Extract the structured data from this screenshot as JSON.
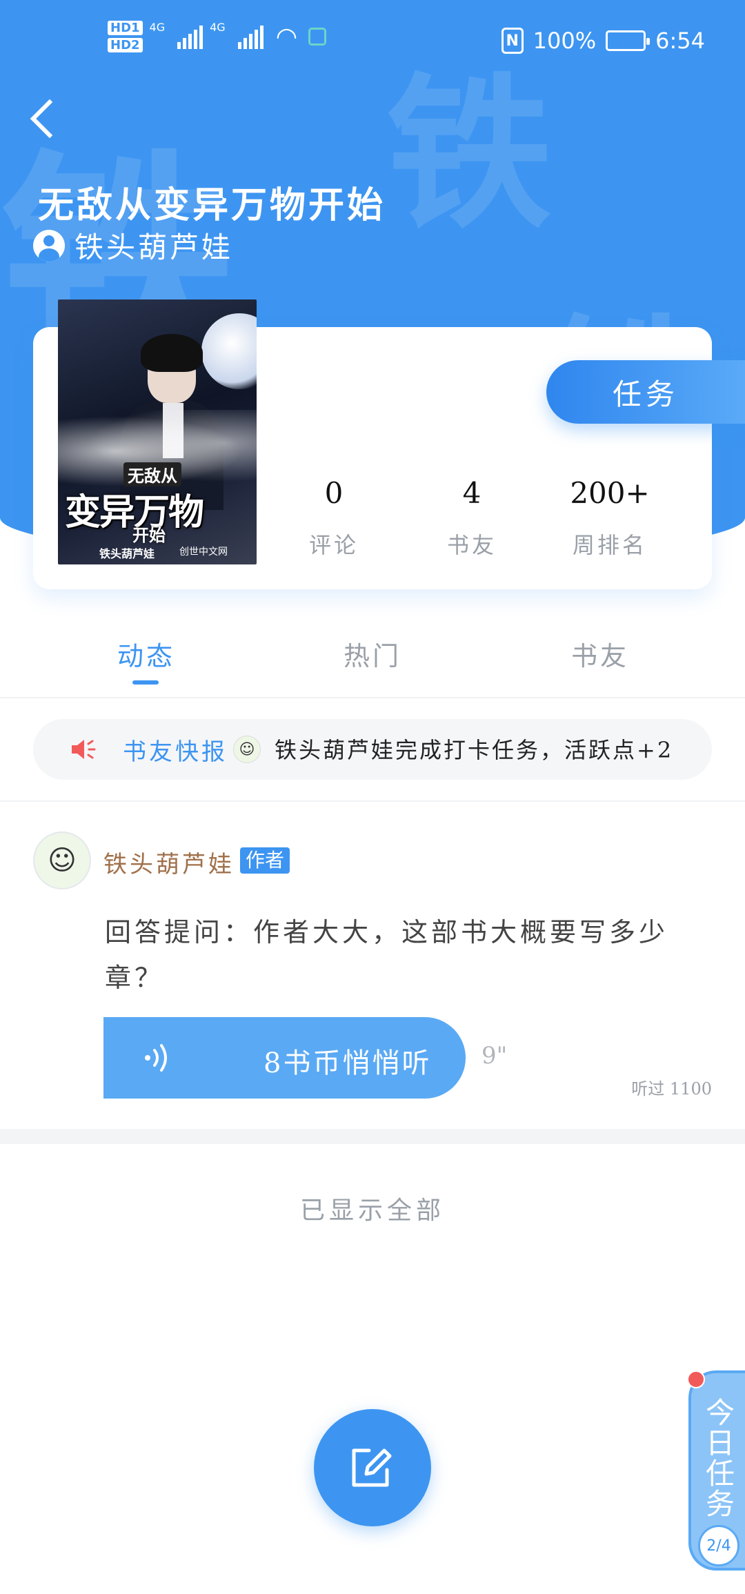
{
  "status_bar": {
    "hd1": "HD1",
    "hd2": "HD2",
    "net1": "4G",
    "net2": "4G",
    "nfc": "N",
    "battery": "100%",
    "time": "6:54"
  },
  "header": {
    "book_title": "无敌从变异万物开始",
    "author": "铁头葫芦娃",
    "watermark": "铁"
  },
  "cover": {
    "line1": "无敌从",
    "line2": "变异万物",
    "line3": "开始",
    "author": "铁头葫芦娃",
    "publisher": "创世中文网"
  },
  "task_button": "任务",
  "stats": [
    {
      "value": "0",
      "label": "评论"
    },
    {
      "value": "4",
      "label": "书友"
    },
    {
      "value": "200+",
      "label": "周排名"
    }
  ],
  "tabs": [
    {
      "label": "动态"
    },
    {
      "label": "热门"
    },
    {
      "label": "书友"
    }
  ],
  "news": {
    "tag": "书友快报",
    "text": "铁头葫芦娃完成打卡任务，活跃点+2"
  },
  "post": {
    "author": "铁头葫芦娃",
    "badge": "作者",
    "text": "回答提问：作者大大，这部书大概要写多少章？",
    "audio_label": "8书币悄悄听",
    "duration": "9\"",
    "listened": "听过 1100"
  },
  "footer": {
    "shown_all": "已显示全部"
  },
  "today_task": {
    "label": "今日任务",
    "progress": "2/4"
  },
  "colors": {
    "brand": "#3d95f1",
    "audio": "#5aa9f4",
    "alert": "#f25a5a"
  }
}
